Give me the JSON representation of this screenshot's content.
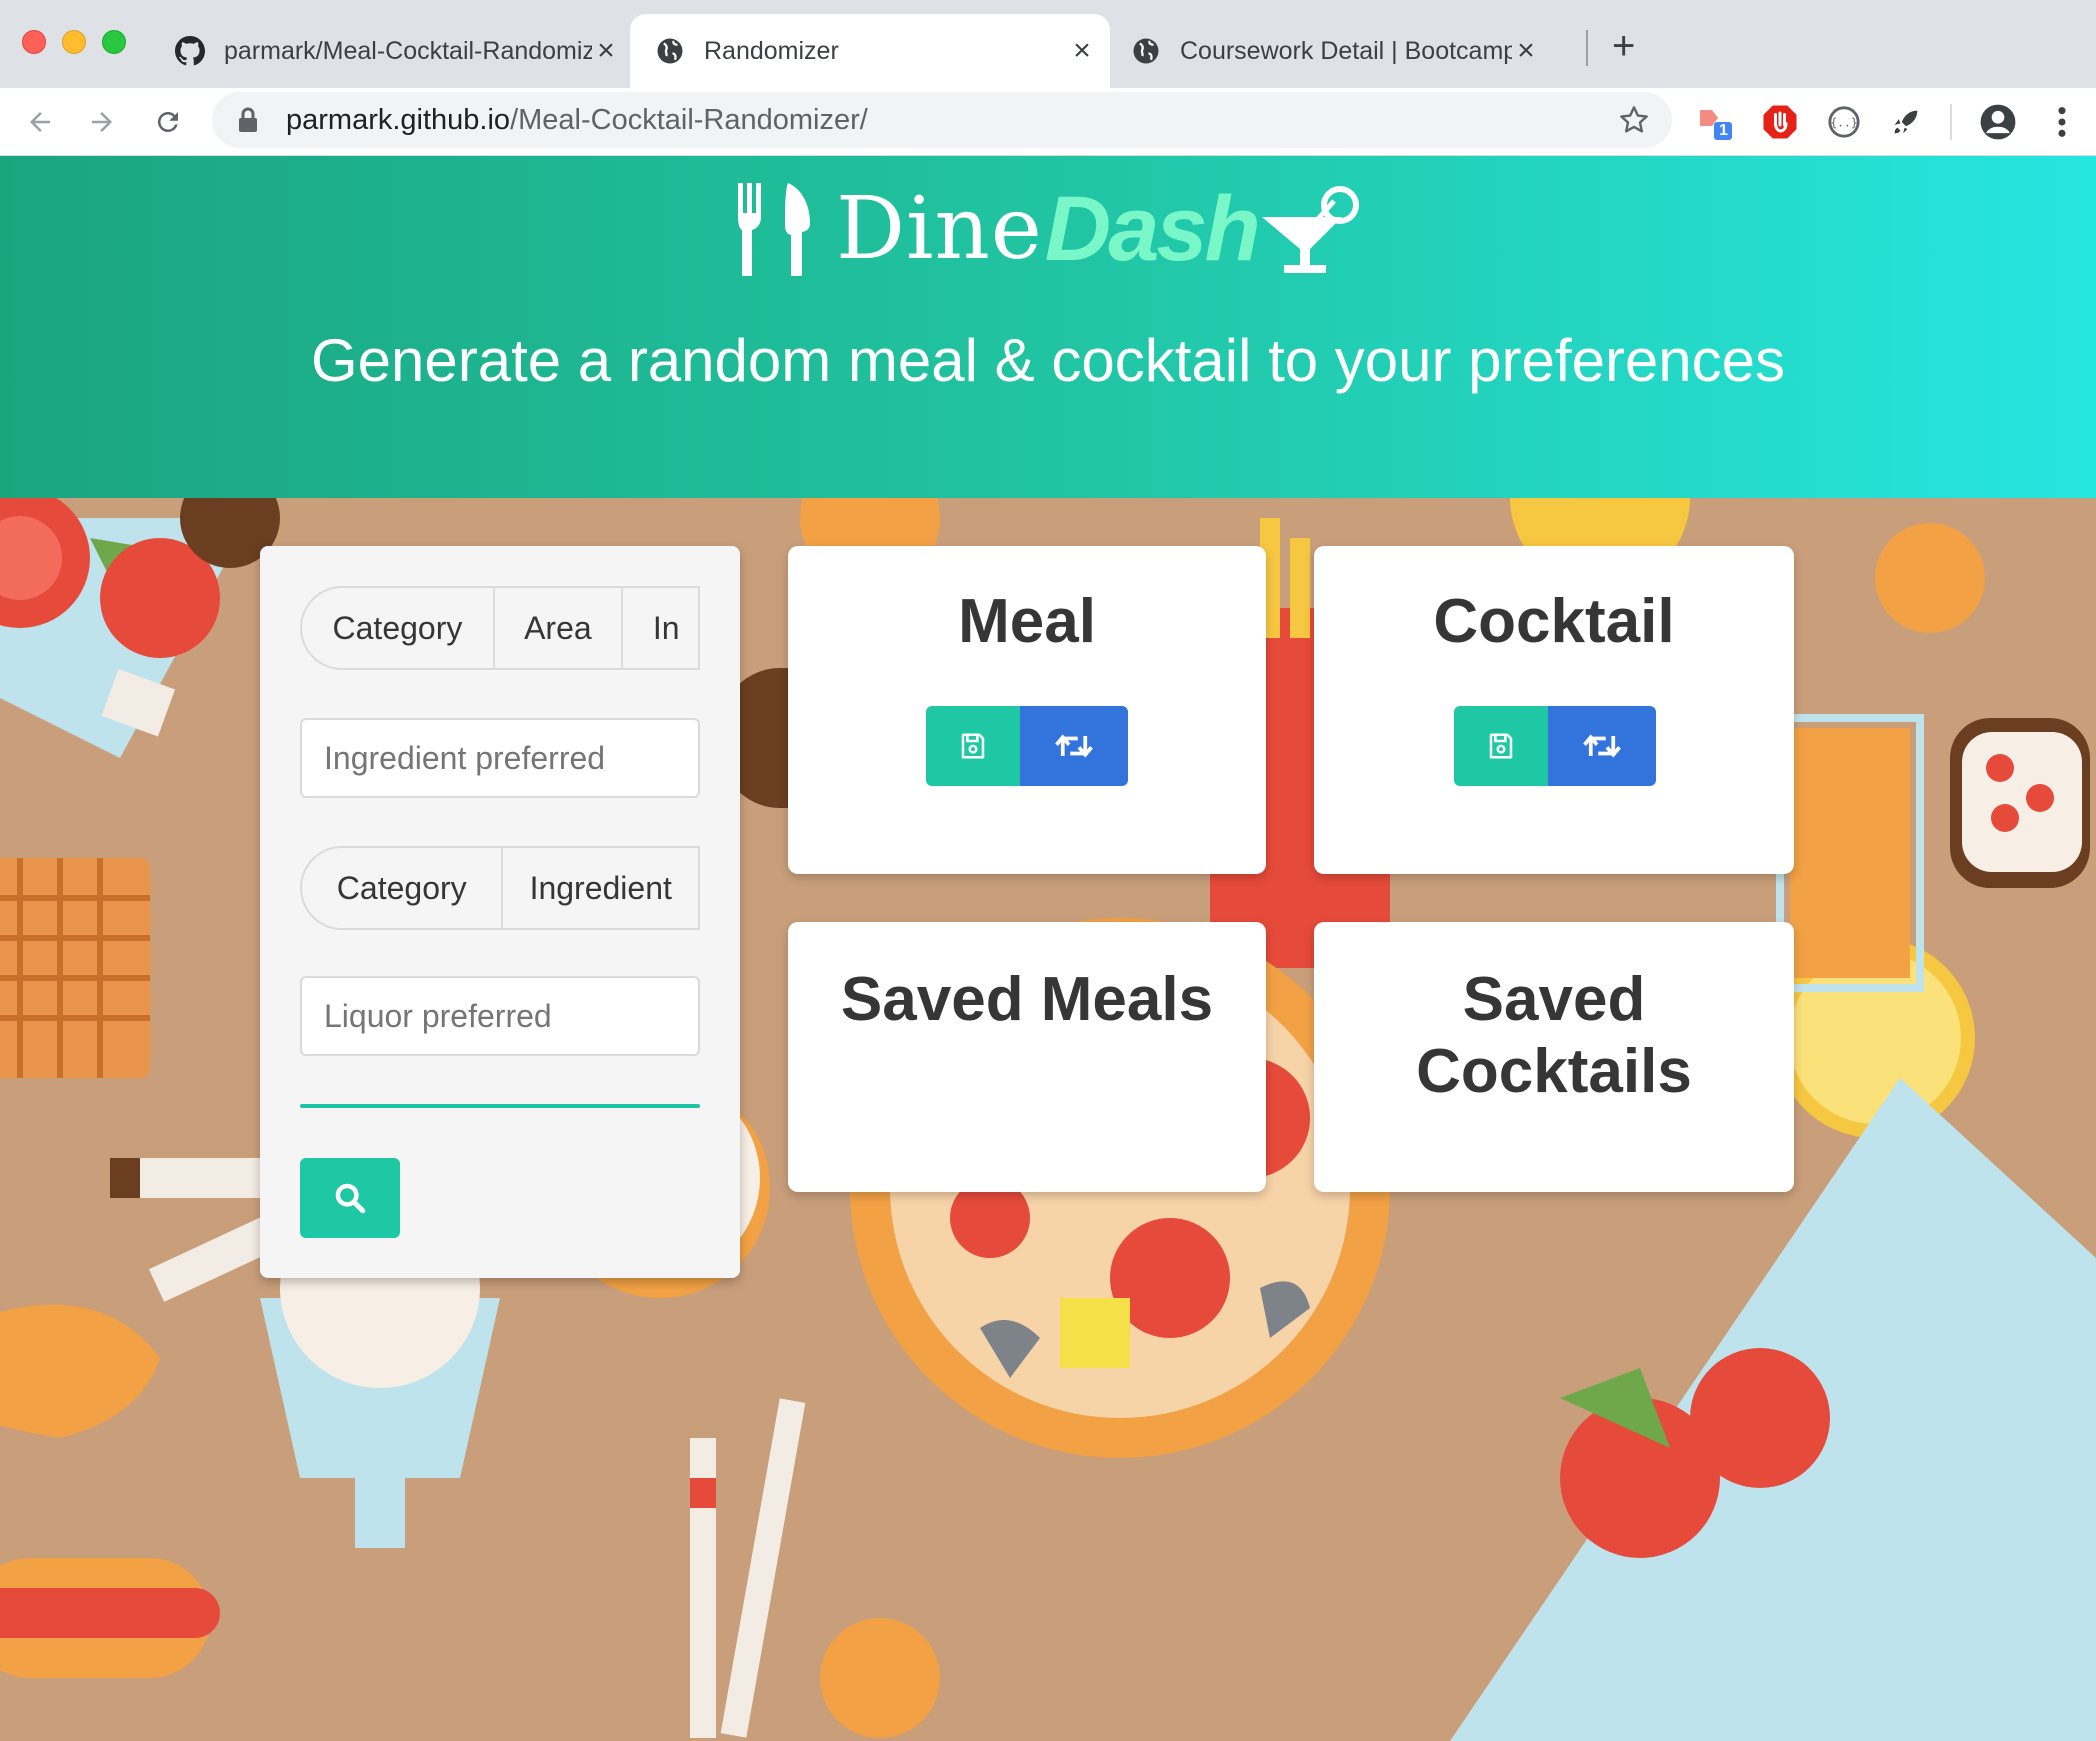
{
  "browser": {
    "tabs": [
      {
        "title": "parmark/Meal-Cocktail-Randomizer",
        "icon": "github-icon"
      },
      {
        "title": "Randomizer",
        "icon": "globe-icon"
      },
      {
        "title": "Coursework Detail | Bootcamp Spot",
        "icon": "globe-icon"
      }
    ],
    "url_domain": "parmark.github.io",
    "url_path": "/Meal-Cocktail-Randomizer/",
    "extension_badge": "1"
  },
  "header": {
    "logo_dine": "Dine",
    "logo_dash": "Dash",
    "tagline": "Generate a random meal & cocktail to your preferences"
  },
  "filters": {
    "meal_tabs": [
      "Category",
      "Area",
      "In"
    ],
    "meal_placeholder": "Ingredient preferred",
    "cocktail_tabs": [
      "Category",
      "Ingredient"
    ],
    "cocktail_placeholder": "Liquor preferred"
  },
  "cards": {
    "meal_title": "Meal",
    "cocktail_title": "Cocktail",
    "saved_meals_title": "Saved Meals",
    "saved_cocktails_title": "Saved Cocktails"
  },
  "colors": {
    "primary": "#1fc8a5",
    "link": "#3273dc",
    "header_start": "#1aa57f",
    "header_end": "#26e6e0",
    "logo_accent": "#7af7c8"
  }
}
